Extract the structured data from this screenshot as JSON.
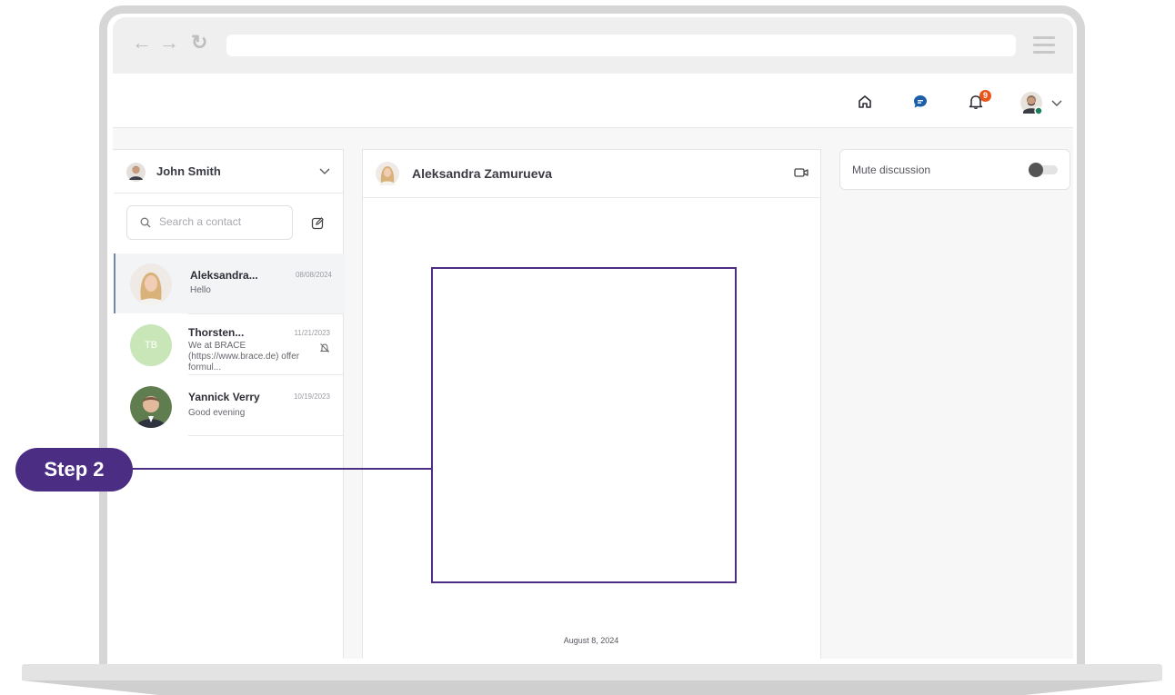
{
  "browser": {
    "back_icon": "←",
    "forward_icon": "→",
    "reload_icon": "↻",
    "url": ""
  },
  "header": {
    "notification_count": "9"
  },
  "account": {
    "name": "John Smith"
  },
  "search": {
    "placeholder": "Search a contact"
  },
  "contacts": [
    {
      "name": "Aleksandra...",
      "date": "08/08/2024",
      "message": "Hello",
      "initials": "",
      "active": true
    },
    {
      "name": "Thorsten...",
      "date": "11/21/2023",
      "message": "We at BRACE (https://www.brace.de) offer formul...",
      "initials": "TB",
      "muted": true
    },
    {
      "name": "Yannick Verry",
      "date": "10/19/2023",
      "message": "Good evening",
      "initials": ""
    }
  ],
  "chat": {
    "contact_name": "Aleksandra Zamurueva",
    "date_separator": "August 8, 2024"
  },
  "settings": {
    "mute_label": "Mute discussion",
    "mute_on": false
  },
  "annotation": {
    "step_label": "Step 2"
  },
  "colors": {
    "accent_purple": "#4b2e83",
    "chat_icon_blue": "#1b5fa8",
    "badge_orange": "#e8541a",
    "avatar_green": "#c9e6b8"
  }
}
